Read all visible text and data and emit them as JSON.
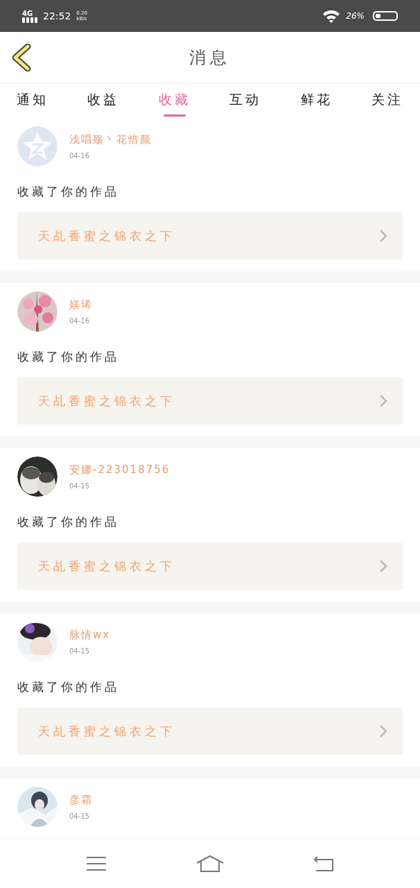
{
  "status_bar": {
    "network": "4G",
    "time": "22:52",
    "speed": "0.20\nkB/s",
    "battery": "26%"
  },
  "header": {
    "title": "消息"
  },
  "tabs": [
    {
      "label": "通知",
      "selected": false
    },
    {
      "label": "收益",
      "selected": false
    },
    {
      "label": "收藏",
      "selected": true
    },
    {
      "label": "互动",
      "selected": false
    },
    {
      "label": "鲜花",
      "selected": false
    },
    {
      "label": "关注",
      "selected": false
    }
  ],
  "messages": [
    {
      "kind": "icon",
      "name": "浅唱殇丶花惜颜",
      "date": "04-16",
      "text": "收藏了你的作品",
      "work": "天乩香蜜之锦衣之下"
    },
    {
      "kind": "picture",
      "name": "媄琋",
      "date": "04-16",
      "text": "收藏了你的作品",
      "work": "天乩香蜜之锦衣之下"
    },
    {
      "kind": "picture",
      "name": "安娜-223018756",
      "date": "04-15",
      "text": "收藏了你的作品",
      "work": "天乩香蜜之锦衣之下"
    },
    {
      "kind": "picture",
      "name": "脉情wx",
      "date": "04-15",
      "text": "收藏了你的作品",
      "work": "天乩香蜜之锦衣之下"
    },
    {
      "kind": "picture",
      "name": "彦霜",
      "date": "04-15"
    }
  ]
}
